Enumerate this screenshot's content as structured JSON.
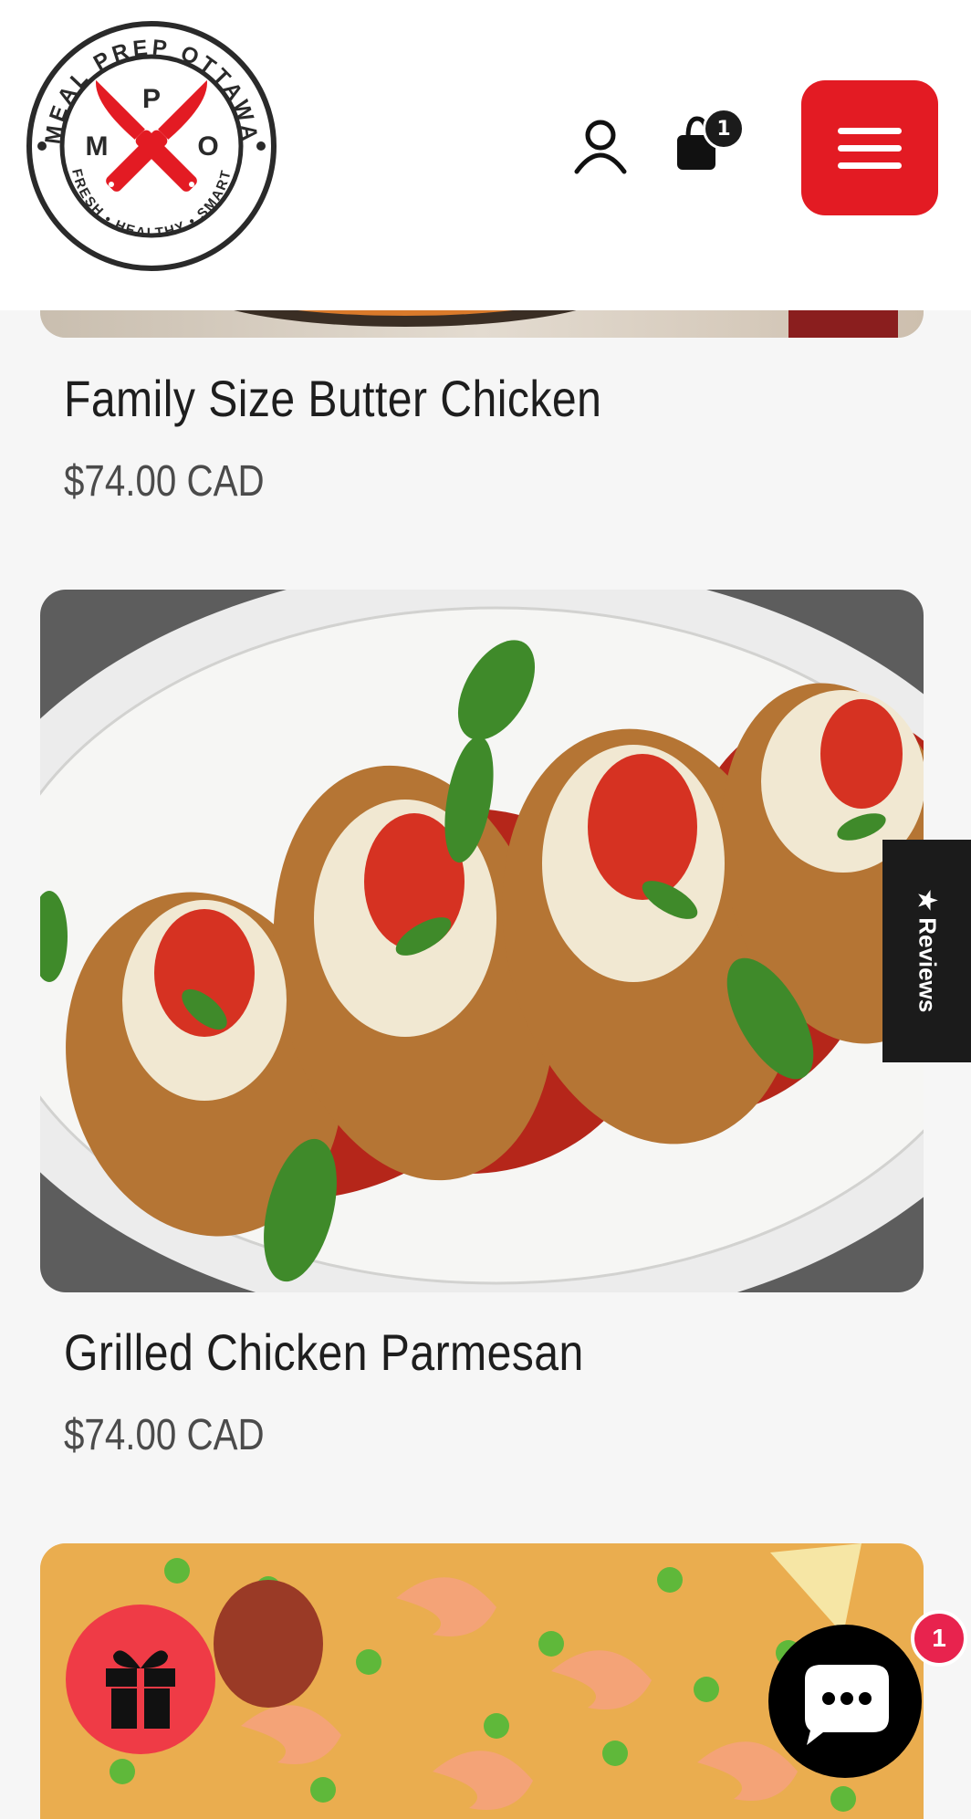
{
  "logo": {
    "top_text": "MEAL PREP OTTAWA",
    "bottom_text": "FRESH • HEALTHY • SMART",
    "letter_m": "M",
    "letter_p": "P",
    "letter_o": "O"
  },
  "header": {
    "cart_count": "1"
  },
  "products": [
    {
      "title": "Family Size Butter Chicken",
      "price": "$74.00 CAD"
    },
    {
      "title": "Grilled Chicken Parmesan",
      "price": "$74.00 CAD"
    }
  ],
  "reviews_tab": {
    "label": "★ Reviews"
  },
  "chat": {
    "badge_count": "1"
  },
  "colors": {
    "brand_red": "#e31b23",
    "dark": "#1b1b1b",
    "background": "#f6f6f6"
  },
  "icons": [
    "user-icon",
    "shopping-bag-icon",
    "menu-icon",
    "gift-icon",
    "chat-icon"
  ]
}
